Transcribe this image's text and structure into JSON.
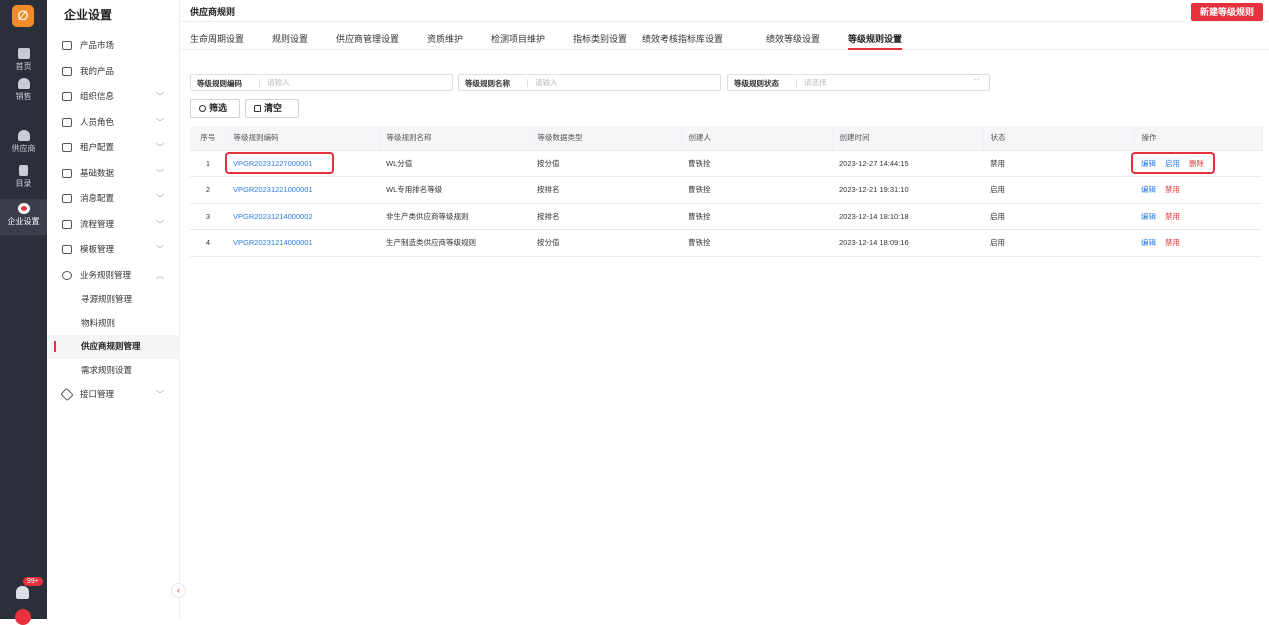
{
  "rail": {
    "items": [
      {
        "label": "首页",
        "icon": "monitor-icon"
      },
      {
        "label": "销售",
        "icon": "person-icon"
      },
      {
        "label": "供应商",
        "icon": "person-icon"
      },
      {
        "label": "目录",
        "icon": "book-icon"
      },
      {
        "label": "企业设置",
        "icon": "settings-icon"
      }
    ],
    "badge": "99+"
  },
  "sidebar": {
    "title": "企业设置",
    "items": [
      {
        "label": "产品市场",
        "icon": "store-icon",
        "chev": ""
      },
      {
        "label": "我的产品",
        "icon": "cube-icon",
        "chev": ""
      },
      {
        "label": "组织信息",
        "icon": "building-icon",
        "chev": "﹀"
      },
      {
        "label": "人员角色",
        "icon": "users-icon",
        "chev": "﹀"
      },
      {
        "label": "租户配置",
        "icon": "tenant-icon",
        "chev": "﹀"
      },
      {
        "label": "基础数据",
        "icon": "grid-icon",
        "chev": "﹀"
      },
      {
        "label": "消息配置",
        "icon": "message-icon",
        "chev": "﹀"
      },
      {
        "label": "流程管理",
        "icon": "flow-icon",
        "chev": "﹀"
      },
      {
        "label": "模板管理",
        "icon": "template-icon",
        "chev": "﹀"
      },
      {
        "label": "业务规则管理",
        "icon": "gear-icon",
        "chev": "︿"
      }
    ],
    "sub_items": [
      "寻源规则管理",
      "物料规则",
      "供应商规则管理",
      "需求规则设置"
    ],
    "last_item": {
      "label": "接口管理",
      "icon": "plug-icon",
      "chev": "﹀"
    },
    "collapse": "‹"
  },
  "header": {
    "title": "供应商规则",
    "new_button": "新建等级规则"
  },
  "tabs": [
    "生命周期设置",
    "规则设置",
    "供应商管理设置",
    "资质维护",
    "检测项目维护",
    "指标类别设置",
    "绩效考核指标库设置",
    "绩效等级设置",
    "等级规则设置"
  ],
  "filters": {
    "code_label": "等级规则编码",
    "code_placeholder": "请输入",
    "name_label": "等级规则名称",
    "name_placeholder": "请输入",
    "status_label": "等级规则状态",
    "status_placeholder": "请选择"
  },
  "buttons": {
    "search": "筛选",
    "clear": "清空"
  },
  "table": {
    "headers": [
      "序号",
      "等级规则编码",
      "等级规则名称",
      "等级数据类型",
      "创建人",
      "创建时间",
      "状态",
      "操作"
    ],
    "rows": [
      {
        "seq": "1",
        "code": "VPGR20231227000001",
        "name": "WL分值",
        "type": "按分值",
        "creator": "曹铁拴",
        "time": "2023-12-27 14:44:15",
        "status": "禁用",
        "actions": [
          "编辑",
          "启用",
          "删除"
        ]
      },
      {
        "seq": "2",
        "code": "VPGR20231221000001",
        "name": "WL专用排名等级",
        "type": "按排名",
        "creator": "曹铁拴",
        "time": "2023-12-21 19:31:10",
        "status": "启用",
        "actions": [
          "编辑",
          "禁用"
        ]
      },
      {
        "seq": "3",
        "code": "VPGR20231214000002",
        "name": "非生产类供应商等级规则",
        "type": "按排名",
        "creator": "曹铁拴",
        "time": "2023-12-14 18:10:18",
        "status": "启用",
        "actions": [
          "编辑",
          "禁用"
        ]
      },
      {
        "seq": "4",
        "code": "VPGR20231214000001",
        "name": "生产制造类供应商等级规则",
        "type": "按分值",
        "creator": "曹铁拴",
        "time": "2023-12-14 18:09:16",
        "status": "启用",
        "actions": [
          "编辑",
          "禁用"
        ]
      }
    ]
  },
  "colors": {
    "accent": "#e7323d",
    "link": "#2b7be0",
    "rail": "#2b2f3a"
  }
}
